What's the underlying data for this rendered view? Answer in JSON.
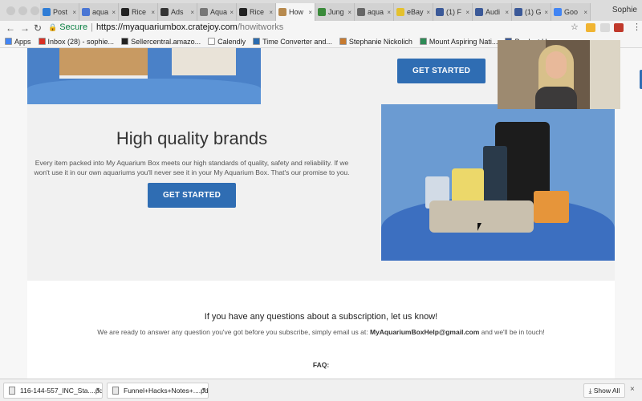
{
  "browser": {
    "tabs": [
      {
        "label": "Post",
        "color": "#2e7cd6"
      },
      {
        "label": "aqua",
        "color": "#4a76d4"
      },
      {
        "label": "Rice",
        "color": "#222222"
      },
      {
        "label": "Ads",
        "color": "#333333"
      },
      {
        "label": "Aqua",
        "color": "#777777"
      },
      {
        "label": "Rice",
        "color": "#222222"
      },
      {
        "label": "How",
        "color": "#b78a4e",
        "active": true
      },
      {
        "label": "Jung",
        "color": "#3a8a3a"
      },
      {
        "label": "aqua",
        "color": "#666666"
      },
      {
        "label": "eBay",
        "color": "#e4c12e"
      },
      {
        "label": "(1) F",
        "color": "#3b5998"
      },
      {
        "label": "Audi",
        "color": "#3b5998"
      },
      {
        "label": "(1) G",
        "color": "#3b5998"
      },
      {
        "label": "Goo",
        "color": "#4285f4"
      }
    ],
    "tab_close": "×",
    "profile_name": "Sophie",
    "secure_label": "Secure",
    "url_host": "https://myaquariumbox.cratejoy.com",
    "url_path": "/howitworks",
    "icons": {
      "back": "←",
      "forward": "→",
      "reload": "↻",
      "star": "☆",
      "menu": "⋮",
      "lock": "🔒"
    },
    "extension_colors": [
      "#f0b432",
      "#dadada",
      "#c0392b",
      "#d0d0d0"
    ],
    "bookmarks": [
      {
        "label": "Apps",
        "color": "#4285f4"
      },
      {
        "label": "Inbox (28) - sophie...",
        "color": "#d93025"
      },
      {
        "label": "Sellercentral.amazo...",
        "color": "#222222"
      },
      {
        "label": "Calendly",
        "color": "#ffffff"
      },
      {
        "label": "Time Converter and...",
        "color": "#2b6cb0"
      },
      {
        "label": "Stephanie Nickolich",
        "color": "#c77b30"
      },
      {
        "label": "Mount Aspiring Nati...",
        "color": "#2e8b57"
      },
      {
        "label": "Product U...",
        "color": "#3b5998"
      }
    ]
  },
  "page": {
    "button_label": "GET STARTED",
    "section_heading": "High quality brands",
    "section_text": "Every item packed into My Aquarium Box meets our high standards of quality, safety and reliability. If we won't use it in our own aquariums you'll never see it in your My Aquarium Box. That's our promise to you.",
    "questions_title": "If you have any questions about a subscription, let us know!",
    "questions_text_before": "We are ready to answer any question you've got before you subscribe, simply email us at: ",
    "questions_email": "MyAquariumBoxHelp@gmail.com",
    "questions_text_after": " and we'll be in touch!",
    "faq_label": "FAQ:"
  },
  "downloads": {
    "items": [
      {
        "label": "116-144-557_INC_Sta....pdf"
      },
      {
        "label": "Funnel+Hacks+Notes+....pdf"
      }
    ],
    "caret": "▾",
    "show_all": "Show All",
    "download_icon": "⤓",
    "close": "×"
  }
}
